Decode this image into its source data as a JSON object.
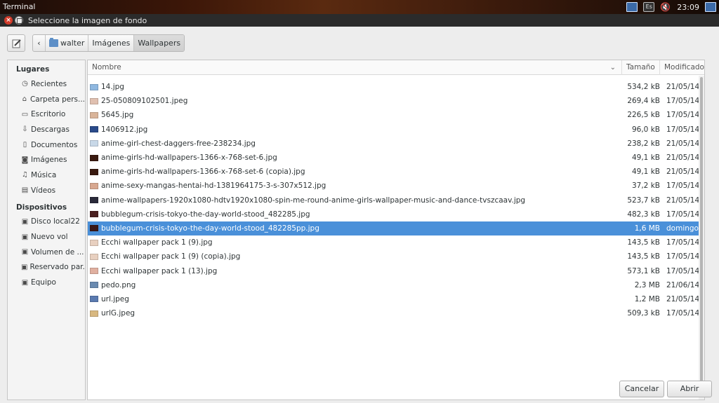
{
  "panel": {
    "title": "Terminal",
    "keyboard_layout": "Es",
    "clock": "23:09",
    "icons": [
      "network-icon",
      "keyboard-layout-icon",
      "volume-muted-icon",
      "display-icon"
    ]
  },
  "dialog": {
    "title": "Seleccione la imagen de fondo"
  },
  "pathbar": {
    "segments": [
      "walter",
      "Imágenes",
      "Wallpapers"
    ],
    "active_index": 2
  },
  "sidebar": {
    "places_header": "Lugares",
    "places": [
      {
        "label": "Recientes",
        "icon": "clock-icon"
      },
      {
        "label": "Carpeta pers...",
        "icon": "home-icon"
      },
      {
        "label": "Escritorio",
        "icon": "desktop-icon"
      },
      {
        "label": "Descargas",
        "icon": "download-icon"
      },
      {
        "label": "Documentos",
        "icon": "document-icon"
      },
      {
        "label": "Imágenes",
        "icon": "camera-icon"
      },
      {
        "label": "Música",
        "icon": "music-icon"
      },
      {
        "label": "Vídeos",
        "icon": "film-icon"
      }
    ],
    "devices_header": "Dispositivos",
    "devices": [
      {
        "label": "Disco local22",
        "icon": "drive-icon"
      },
      {
        "label": "Nuevo vol",
        "icon": "drive-icon"
      },
      {
        "label": "Volumen de ...",
        "icon": "drive-icon"
      },
      {
        "label": "Reservado par...",
        "icon": "drive-icon"
      },
      {
        "label": "Equipo",
        "icon": "drive-icon"
      }
    ]
  },
  "filelist": {
    "columns": {
      "name": "Nombre",
      "size": "Tamaño",
      "modified": "Modificado"
    },
    "files": [
      {
        "name": "14.jpg",
        "size": "534,2 kB",
        "modified": "21/05/14",
        "color": "#8fb8e0"
      },
      {
        "name": "25-050809102501.jpeg",
        "size": "269,4 kB",
        "modified": "17/05/14",
        "color": "#e0c0b0"
      },
      {
        "name": "5645.jpg",
        "size": "226,5 kB",
        "modified": "17/05/14",
        "color": "#d9b49a"
      },
      {
        "name": "1406912.jpg",
        "size": "96,0 kB",
        "modified": "17/05/14",
        "color": "#2a4a8a"
      },
      {
        "name": "anime-girl-chest-daggers-free-238234.jpg",
        "size": "238,2 kB",
        "modified": "21/05/14",
        "color": "#c8d8e8"
      },
      {
        "name": "anime-girls-hd-wallpapers-1366-x-768-set-6.jpg",
        "size": "49,1 kB",
        "modified": "21/05/14",
        "color": "#3a1a10"
      },
      {
        "name": "anime-girls-hd-wallpapers-1366-x-768-set-6 (copia).jpg",
        "size": "49,1 kB",
        "modified": "21/05/14",
        "color": "#3a1a10"
      },
      {
        "name": "anime-sexy-mangas-hentai-hd-1381964175-3-s-307x512.jpg",
        "size": "37,2 kB",
        "modified": "17/05/14",
        "color": "#d8a890"
      },
      {
        "name": "anime-wallpapers-1920x1080-hdtv1920x1080-spin-me-round-anime-girls-wallpaper-music-and-dance-tvszcaav.jpg",
        "size": "523,7 kB",
        "modified": "21/05/14",
        "color": "#2a2a3a"
      },
      {
        "name": "bubblegum-crisis-tokyo-the-day-world-stood_482285.jpg",
        "size": "482,3 kB",
        "modified": "17/05/14",
        "color": "#4a2020"
      },
      {
        "name": "bubblegum-crisis-tokyo-the-day-world-stood_482285pp.jpg",
        "size": "1,6 MB",
        "modified": "domingo",
        "color": "#3a1818",
        "selected": true
      },
      {
        "name": "Ecchi wallpaper pack 1 (9).jpg",
        "size": "143,5 kB",
        "modified": "17/05/14",
        "color": "#e8d0c0"
      },
      {
        "name": "Ecchi wallpaper pack 1 (9) (copia).jpg",
        "size": "143,5 kB",
        "modified": "17/05/14",
        "color": "#e8d0c0"
      },
      {
        "name": "Ecchi wallpaper pack 1 (13).jpg",
        "size": "573,1 kB",
        "modified": "17/05/14",
        "color": "#e0b0a0"
      },
      {
        "name": "pedo.png",
        "size": "2,3 MB",
        "modified": "21/06/14",
        "color": "#6a8ab0"
      },
      {
        "name": "url.jpeg",
        "size": "1,2 MB",
        "modified": "21/05/14",
        "color": "#5a7ab0"
      },
      {
        "name": "urlG.jpeg",
        "size": "509,3 kB",
        "modified": "17/05/14",
        "color": "#d8b880"
      }
    ]
  },
  "buttons": {
    "cancel": "Cancelar",
    "open": "Abrir"
  }
}
